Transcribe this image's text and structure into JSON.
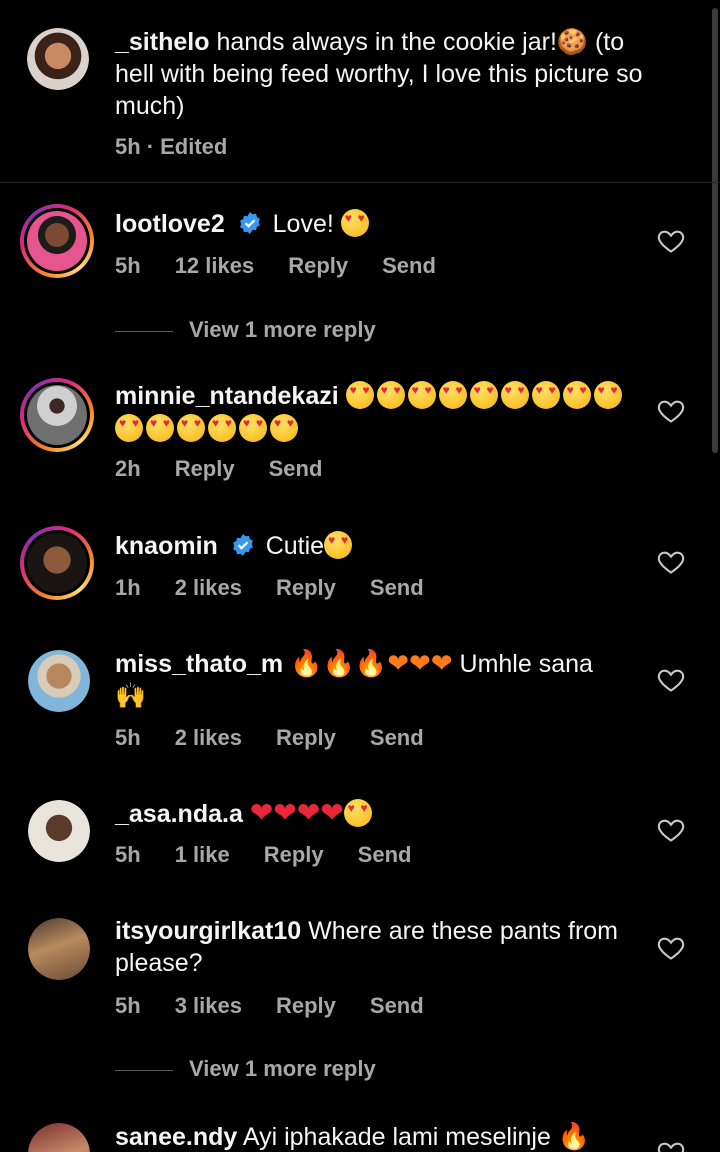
{
  "caption": {
    "username": "_sithelo",
    "text": "hands always in the cookie jar!🍪 (to hell with being feed worthy, I love this picture so much)",
    "time": "5h",
    "edited": "· Edited"
  },
  "comments": [
    {
      "username": "lootlove2",
      "verified": true,
      "text": "Love!",
      "emojis": [
        "love"
      ],
      "time": "5h",
      "likes": "12 likes",
      "reply": "Reply",
      "send": "Send",
      "story": true,
      "view_more": "View 1 more reply"
    },
    {
      "username": "minnie_ntandekazi",
      "verified": false,
      "text": "",
      "emojis_line1": 9,
      "emojis_line2": 6,
      "time": "2h",
      "reply": "Reply",
      "send": "Send",
      "story": true
    },
    {
      "username": "knaomin",
      "verified": true,
      "text": "Cutie",
      "emojis": [
        "love"
      ],
      "time": "1h",
      "likes": "2 likes",
      "reply": "Reply",
      "send": "Send",
      "story": true
    },
    {
      "username": "miss_thato_m",
      "verified": false,
      "text": "Umhle sana",
      "prefix": "🔥🔥🔥❤❤❤",
      "suffix": "🙌",
      "time": "5h",
      "likes": "2 likes",
      "reply": "Reply",
      "send": "Send",
      "story": false
    },
    {
      "username": "_asa.nda.a",
      "verified": false,
      "prefix": "❤❤❤❤",
      "emojis": [
        "love"
      ],
      "time": "5h",
      "likes": "1 like",
      "reply": "Reply",
      "send": "Send",
      "story": false
    },
    {
      "username": "itsyourgirlkat10",
      "verified": false,
      "text": "Where are these pants from please?",
      "time": "5h",
      "likes": "3 likes",
      "reply": "Reply",
      "send": "Send",
      "story": false,
      "view_more": "View 1 more reply"
    },
    {
      "username": "sanee.ndy",
      "verified": false,
      "text": "Ayi iphakade lami meselinje",
      "suffix": "🔥",
      "story": false
    }
  ],
  "colors": {
    "background": "#000000",
    "text": "#f5f5f5",
    "meta": "#a8a8a8",
    "verified": "#3897f0",
    "heart": "#e8283a"
  },
  "icons": {
    "like": "heart-outline-icon",
    "verified": "verified-badge-icon"
  }
}
